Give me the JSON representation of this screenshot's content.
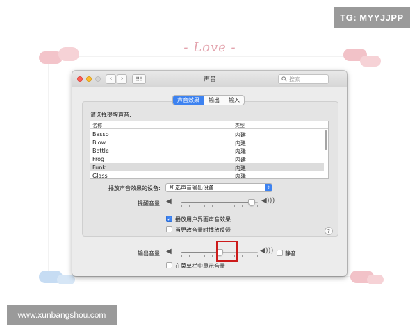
{
  "decor": {
    "love_text": "- Love -",
    "heart_color_pink": "#f2c2c8",
    "heart_color_blue": "#c6dcf3"
  },
  "watermarks": {
    "top_right": "TG: MYYJJPP",
    "bottom_left": "www.xunbangshou.com"
  },
  "window": {
    "title": "声音",
    "search_placeholder": "搜索",
    "search_icon": "magnifier-icon",
    "back_icon": "‹",
    "forward_icon": "›",
    "grid_icon": "⠿⠿"
  },
  "tabs": [
    {
      "label": "声音效果",
      "active": true
    },
    {
      "label": "输出",
      "active": false
    },
    {
      "label": "输入",
      "active": false
    }
  ],
  "alert_section": {
    "heading": "请选择提醒声音:",
    "columns": [
      "名称",
      "类型"
    ],
    "rows": [
      {
        "name": "Basso",
        "type": "内建",
        "selected": false
      },
      {
        "name": "Blow",
        "type": "内建",
        "selected": false
      },
      {
        "name": "Bottle",
        "type": "内建",
        "selected": false
      },
      {
        "name": "Frog",
        "type": "内建",
        "selected": false
      },
      {
        "name": "Funk",
        "type": "内建",
        "selected": true
      },
      {
        "name": "Glass",
        "type": "内建",
        "selected": false
      }
    ]
  },
  "device": {
    "label": "播放声音效果的设备:",
    "value": "所选声音输出设备"
  },
  "alert_volume": {
    "label": "提醒音量:",
    "level": 0.92
  },
  "options": [
    {
      "label": "播放用户界面声音效果",
      "checked": true
    },
    {
      "label": "当更改音量时播放反馈",
      "checked": false
    }
  ],
  "help_label": "?",
  "output_volume": {
    "label": "输出音量:",
    "level": 0.5,
    "mute_label": "静音",
    "mute_checked": false
  },
  "menubar_option": {
    "label": "在菜单栏中显示音量",
    "checked": false
  },
  "colors": {
    "accent": "#3d82f0",
    "highlight_box": "#cc1b1b"
  }
}
